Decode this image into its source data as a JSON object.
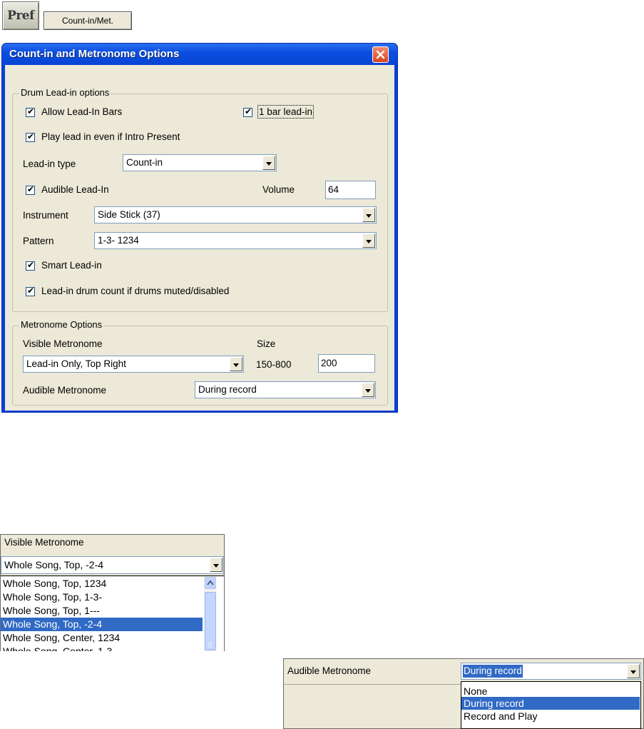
{
  "toolbar": {
    "pref_label": "Pref",
    "countin_label": "Count-in/Met."
  },
  "dialog": {
    "title": "Count-in and Metronome Options",
    "drum_group": {
      "legend": "Drum Lead-in options",
      "allow_leadin": "Allow Lead-In Bars",
      "one_bar": "1 bar lead-in",
      "play_even_intro": "Play lead in even if Intro Present",
      "leadin_type_label": "Lead-in type",
      "leadin_type_value": "Count-in",
      "audible_leadin": "Audible Lead-In",
      "volume_label": "Volume",
      "volume_value": "64",
      "instrument_label": "Instrument",
      "instrument_value": "Side Stick (37)",
      "pattern_label": "Pattern",
      "pattern_value": "1-3- 1234",
      "smart_leadin": "Smart Lead-in",
      "drum_count_muted": "Lead-in drum count if drums muted/disabled"
    },
    "metronome_group": {
      "legend": "Metronome Options",
      "visible_label": "Visible Metronome",
      "visible_value": "Lead-in Only, Top Right",
      "size_label": "Size",
      "size_range": "150-800",
      "size_value": "200",
      "audible_label": "Audible Metronome",
      "audible_value": "During record"
    }
  },
  "visible_popup": {
    "label": "Visible Metronome",
    "selected": "Whole Song, Top, -2-4",
    "options": [
      "Whole Song, Top, 1234",
      "Whole Song, Top, 1-3-",
      "Whole Song, Top, 1---",
      "Whole Song, Top, -2-4",
      "Whole Song, Center, 1234"
    ],
    "highlighted_index": 3
  },
  "audible_popup": {
    "label": "Audible Metronome",
    "selected": "During record",
    "options": [
      "None",
      "During record",
      "Record and Play"
    ],
    "highlighted_index": 1
  },
  "colors": {
    "title_bar": "#0a4fe0",
    "selection": "#316ac5",
    "dialog_face": "#ece9d8"
  }
}
